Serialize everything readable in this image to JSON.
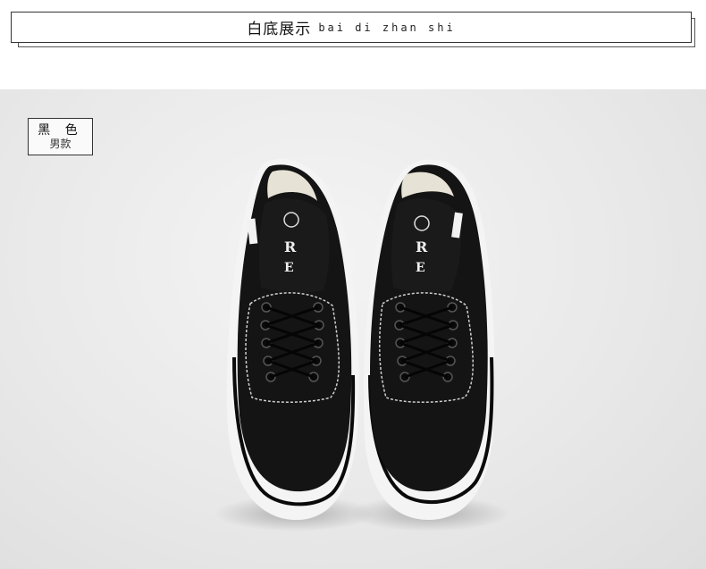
{
  "header": {
    "title_zh": "白底展示",
    "title_pinyin": "bai di zhan shi"
  },
  "color_tag": {
    "color_name": "黑 色",
    "style_label": "男款"
  },
  "product": {
    "image_icon": "sneaker-pair-photo",
    "upper_color": "#111111",
    "sole_color": "#f5f5f5",
    "stripe_color": "#0a0a0a"
  }
}
